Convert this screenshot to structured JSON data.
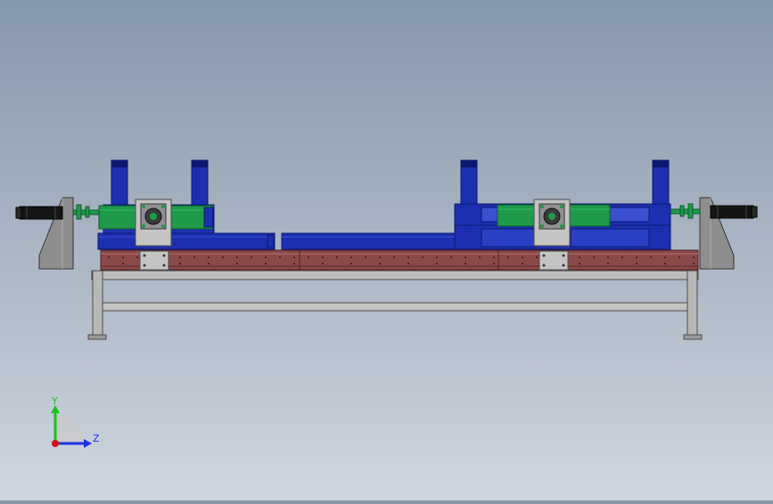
{
  "viewport": {
    "background_top": "#8797ab",
    "background_bottom": "#cfd6df"
  },
  "colors": {
    "blue": "#1b2fb0",
    "blue_dark": "#0c1870",
    "green": "#1e9a4a",
    "green_dark": "#0d5a2a",
    "rail": "#8a4a4a",
    "rail_dark": "#5a2828",
    "steel": "#8e8e8e",
    "steel_light": "#c4c4c4",
    "steel_dark": "#4c4c4c",
    "black": "#151515"
  },
  "triad": {
    "y_label": "Y",
    "z_label": "Z",
    "y_color": "#1bc21b",
    "z_color": "#1c33e0",
    "x_color": "#d01010"
  }
}
